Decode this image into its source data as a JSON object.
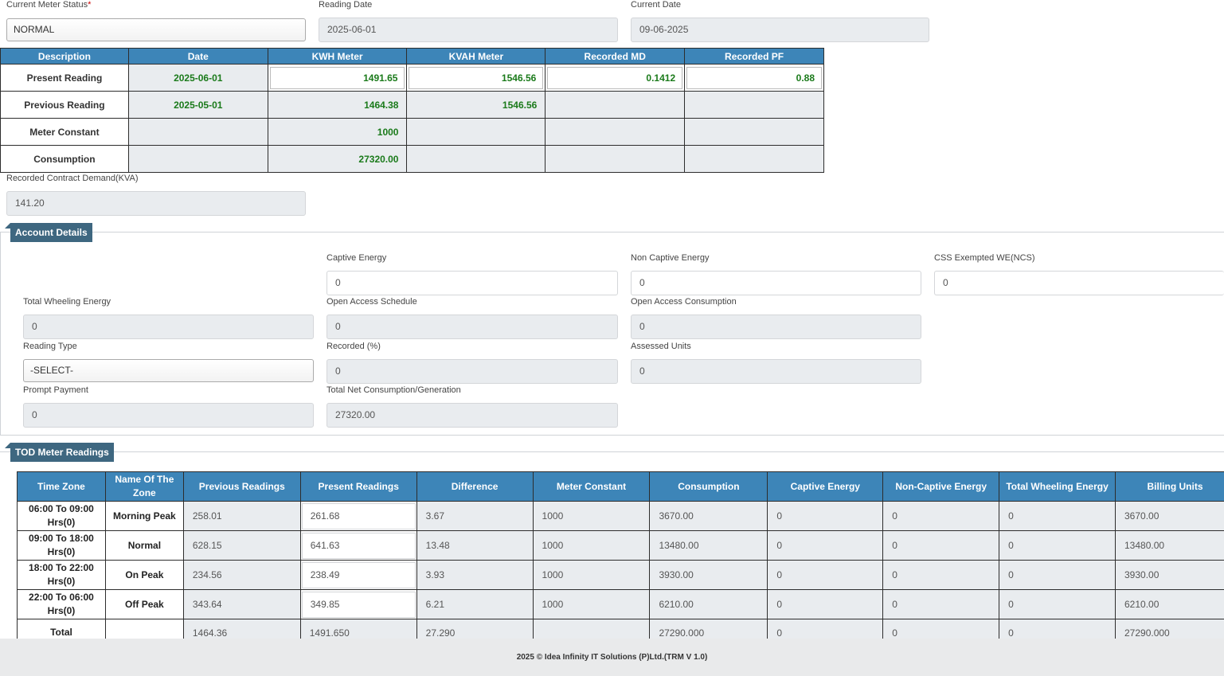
{
  "meter_status": {
    "label": "Current Meter Status",
    "required_mark": "*",
    "value": "NORMAL"
  },
  "reading_date": {
    "label": "Reading Date",
    "value": "2025-06-01"
  },
  "current_date": {
    "label": "Current Date",
    "value": "09-06-2025"
  },
  "meter_table": {
    "headers": [
      "Description",
      "Date",
      "KWH Meter",
      "KVAH Meter",
      "Recorded MD",
      "Recorded PF"
    ],
    "rows": [
      {
        "desc": "Present Reading",
        "date": "2025-06-01",
        "kwh": "1491.65",
        "kvah": "1546.56",
        "md": "0.1412",
        "pf": "0.88"
      },
      {
        "desc": "Previous Reading",
        "date": "2025-05-01",
        "kwh": "1464.38",
        "kvah": "1546.56",
        "md": "",
        "pf": ""
      },
      {
        "desc": "Meter Constant",
        "date": "",
        "kwh": "1000",
        "kvah": "",
        "md": "",
        "pf": ""
      },
      {
        "desc": "Consumption",
        "date": "",
        "kwh": "27320.00",
        "kvah": "",
        "md": "",
        "pf": ""
      }
    ]
  },
  "contract_demand": {
    "label": "Recorded Contract Demand(KVA)",
    "value": "141.20"
  },
  "account_details": {
    "title": "Account Details",
    "captive_energy": {
      "label": "Captive Energy",
      "value": "0"
    },
    "non_captive_energy": {
      "label": "Non Captive Energy",
      "value": "0"
    },
    "css_exempted": {
      "label": "CSS Exempted WE(NCS)",
      "value": "0"
    },
    "total_wheeling": {
      "label": "Total Wheeling Energy",
      "value": "0"
    },
    "oa_schedule": {
      "label": "Open Access Schedule",
      "value": "0"
    },
    "oa_consumption": {
      "label": "Open Access Consumption",
      "value": "0"
    },
    "reading_type": {
      "label": "Reading Type",
      "value": "-SELECT-"
    },
    "recorded_pct": {
      "label": "Recorded (%)",
      "value": "0"
    },
    "assessed_units": {
      "label": "Assessed Units",
      "value": "0"
    },
    "prompt_payment": {
      "label": "Prompt Payment",
      "value": "0"
    },
    "total_net": {
      "label": "Total Net Consumption/Generation",
      "value": "27320.00"
    }
  },
  "tod": {
    "title": "TOD Meter Readings",
    "headers": [
      "Time Zone",
      "Name Of The Zone",
      "Previous Readings",
      "Present Readings",
      "Difference",
      "Meter Constant",
      "Consumption",
      "Captive Energy",
      "Non-Captive Energy",
      "Total Wheeling Energy",
      "Billing Units"
    ],
    "rows": [
      {
        "tz": "06:00 To 09:00 Hrs(0)",
        "zone": "Morning Peak",
        "prev": "258.01",
        "pres": "261.68",
        "diff": "3.67",
        "mc": "1000",
        "cons": "3670.00",
        "cap": "0",
        "noncap": "0",
        "wheel": "0",
        "bill": "3670.00"
      },
      {
        "tz": "09:00 To 18:00 Hrs(0)",
        "zone": "Normal",
        "prev": "628.15",
        "pres": "641.63",
        "diff": "13.48",
        "mc": "1000",
        "cons": "13480.00",
        "cap": "0",
        "noncap": "0",
        "wheel": "0",
        "bill": "13480.00"
      },
      {
        "tz": "18:00 To 22:00 Hrs(0)",
        "zone": "On Peak",
        "prev": "234.56",
        "pres": "238.49",
        "diff": "3.93",
        "mc": "1000",
        "cons": "3930.00",
        "cap": "0",
        "noncap": "0",
        "wheel": "0",
        "bill": "3930.00"
      },
      {
        "tz": "22:00 To 06:00 Hrs(0)",
        "zone": "Off Peak",
        "prev": "343.64",
        "pres": "349.85",
        "diff": "6.21",
        "mc": "1000",
        "cons": "6210.00",
        "cap": "0",
        "noncap": "0",
        "wheel": "0",
        "bill": "6210.00"
      }
    ],
    "total": {
      "label": "Total",
      "zone": "",
      "prev": "1464.36",
      "pres": "1491.650",
      "diff": "27.290",
      "mc": "",
      "cons": "27290.000",
      "cap": "0",
      "noncap": "0",
      "wheel": "0",
      "bill": "27290.000"
    }
  },
  "footer": {
    "text": "2025 © Idea Infinity IT Solutions (P)Ltd.(TRM V 1.0)"
  }
}
